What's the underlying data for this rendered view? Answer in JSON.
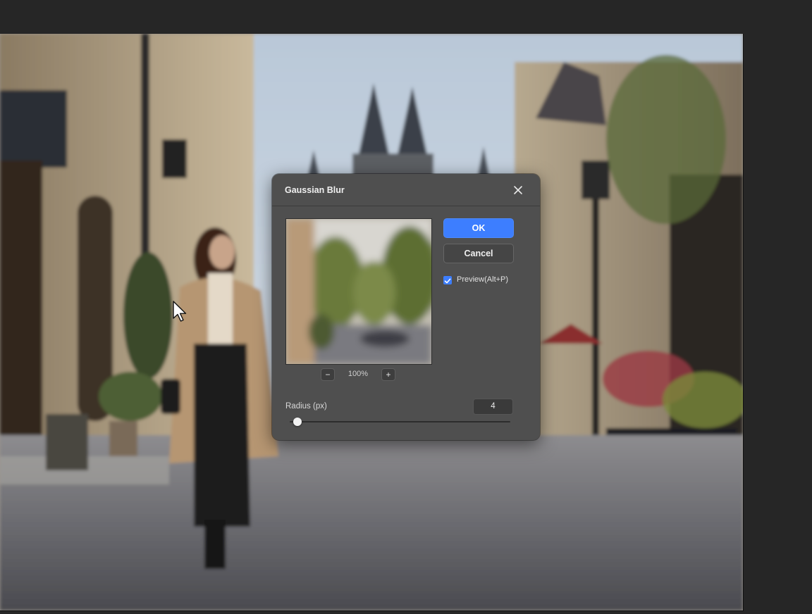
{
  "dialog": {
    "title": "Gaussian Blur",
    "ok_label": "OK",
    "cancel_label": "Cancel",
    "preview_checkbox": {
      "label": "Preview(Alt+P)",
      "checked": true
    },
    "zoom": {
      "minus": "−",
      "level": "100%",
      "plus": "+"
    },
    "radius": {
      "label": "Radius (px)",
      "value": "4",
      "slider_fraction": 0.02
    }
  },
  "icons": {
    "close": "close-icon",
    "check": "check-icon",
    "cursor": "mouse-pointer-icon"
  },
  "colors": {
    "accent": "#3d7eff",
    "dialog_bg": "#4f4f4f",
    "workspace_bg": "#262626"
  }
}
